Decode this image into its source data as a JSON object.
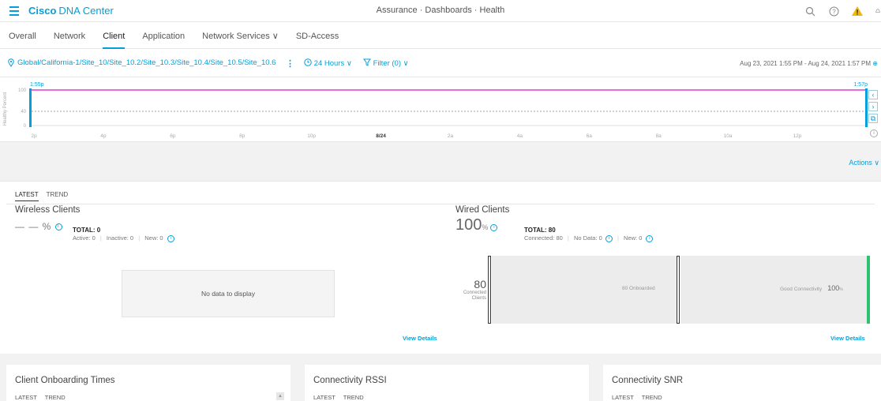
{
  "topbar": {
    "brand_bold": "Cisco",
    "brand_rest": "DNA Center",
    "page_crumb": "Assurance · Dashboards · Health",
    "icons": [
      "search-icon",
      "help-icon",
      "alert-icon",
      "notification-icon"
    ]
  },
  "tabs": [
    {
      "label": "Overall",
      "active": false
    },
    {
      "label": "Network",
      "active": false
    },
    {
      "label": "Client",
      "active": true
    },
    {
      "label": "Application",
      "active": false
    },
    {
      "label": "Network Services ∨",
      "active": false
    },
    {
      "label": "SD-Access",
      "active": false
    }
  ],
  "filters": {
    "location": "Global/California-1/Site_10/Site_10.2/Site_10.3/Site_10.4/Site_10.5/Site_10.6",
    "kebab": "⋮",
    "time": "24 Hours",
    "filter": "Filter (0)",
    "date_range": "Aug 23, 2021 1:55 PM - Aug 24, 2021 1:57 PM"
  },
  "timeline": {
    "ylabel": "Healthy Percent",
    "yticks": [
      "100",
      "40",
      "0"
    ],
    "start_label": "1:55p",
    "end_label": "1:57p",
    "xticks": [
      "2p",
      "4p",
      "6p",
      "8p",
      "10p",
      "8/24",
      "2a",
      "4a",
      "6a",
      "8a",
      "10a",
      "12p"
    ],
    "value_percent": 100,
    "threshold_percent": 40,
    "line_color": "#e03fd0",
    "nav": [
      "‹",
      "›",
      "⧉"
    ]
  },
  "actions_label": "Actions ∨",
  "client_panel": {
    "subtabs": [
      "LATEST",
      "TREND"
    ],
    "wireless": {
      "title": "Wireless Clients",
      "health": "— — %",
      "total": "TOTAL: 0",
      "active": "Active: 0",
      "inactive": "Inactive: 0",
      "new": "New: 0",
      "nodata": "No data to display"
    },
    "wired": {
      "title": "Wired Clients",
      "health": "100",
      "health_unit": "%",
      "total": "TOTAL: 80",
      "connected": "Connected: 80",
      "nodata": "No Data: 0",
      "new": "New: 0",
      "flow_count": "80",
      "flow_count_label": "Connected Clients",
      "onboarded": "80 Onboarded",
      "good_connectivity": "Good Connectivity",
      "good_pct": "100",
      "good_pct_unit": "%",
      "good_color": "#2ec270"
    },
    "view_details": "View Details"
  },
  "bottom_cards": [
    {
      "title": "Client Onboarding Times",
      "subtabs": [
        "LATEST",
        "TREND"
      ]
    },
    {
      "title": "Connectivity RSSI",
      "subtabs": [
        "LATEST",
        "TREND"
      ]
    },
    {
      "title": "Connectivity SNR",
      "subtabs": [
        "LATEST",
        "TREND"
      ]
    }
  ]
}
